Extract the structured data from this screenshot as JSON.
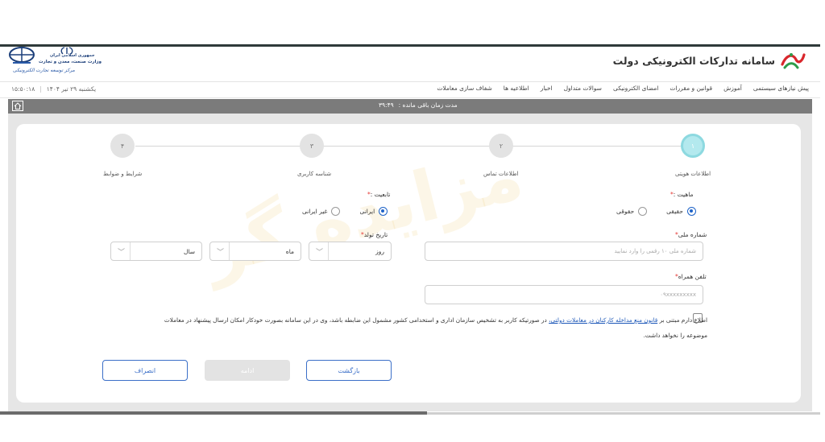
{
  "header": {
    "title": "سامانه تدارکات الکترونیکی دولت",
    "ministry_line1": "جمهوری اسلامی ایران",
    "ministry_line2": "وزارت صنعت، معدن و تجارت",
    "ministry_line3": "مرکز توسعه تجارت الکترونیکی"
  },
  "menu": {
    "items": [
      "پیش نیازهای سیستمی",
      "آموزش",
      "قوانین و مقررات",
      "امضای الکترونیکی",
      "سوالات متداول",
      "اخبار",
      "اطلاعیه ها",
      "شفاف سازی معاملات"
    ],
    "date": "یکشنبه ۲۹ تیر ۱۴۰۴",
    "time": "۱۵:۵۰:۱۸"
  },
  "timer": {
    "label": "مدت زمان باقی مانده :",
    "value": "۳۹:۴۹"
  },
  "steps": [
    {
      "number": "۱",
      "label": "اطلاعات هویتی",
      "active": true
    },
    {
      "number": "۲",
      "label": "اطلاعات تماس",
      "active": false
    },
    {
      "number": "۳",
      "label": "شناسه کاربری",
      "active": false
    },
    {
      "number": "۴",
      "label": "شرایط و ضوابط",
      "active": false
    }
  ],
  "form": {
    "nature_label": "ماهیت :",
    "nature_options": [
      "حقیقی",
      "حقوقی"
    ],
    "nationality_label": "تابعیت :",
    "nationality_options": [
      "ایرانی",
      "غیر ایرانی"
    ],
    "national_id_label": "شماره ملی",
    "national_id_placeholder": "شماره ملی ۱۰ رقمی را وارد نمایید",
    "birth_label": "تاریخ تولد",
    "day_label": "روز",
    "month_label": "ماه",
    "year_label": "سال",
    "mobile_label": "تلفن همراه",
    "mobile_placeholder": "۰۹xxxxxxxxx",
    "terms_prefix": "اطلاع دارم مبتنی بر",
    "terms_link": "قانون منع مداخله کارکنان در معاملات دولتی،",
    "terms_suffix": "در صورتیکه کاربر به تشخیص سازمان اداری و استخدامی کشور مشمول این ضابطه باشد، وی در این سامانه بصورت خودکار امکان ارسال پیشنهاد در معاملات موضوعه را نخواهد داشت."
  },
  "buttons": {
    "back": "بازگشت",
    "continue": "ادامه",
    "cancel": "انصراف"
  },
  "colors": {
    "primary": "#3b6fc8",
    "active_step": "#b3e9ee",
    "timer_bar": "#7b7b7b",
    "required": "#e53935"
  }
}
